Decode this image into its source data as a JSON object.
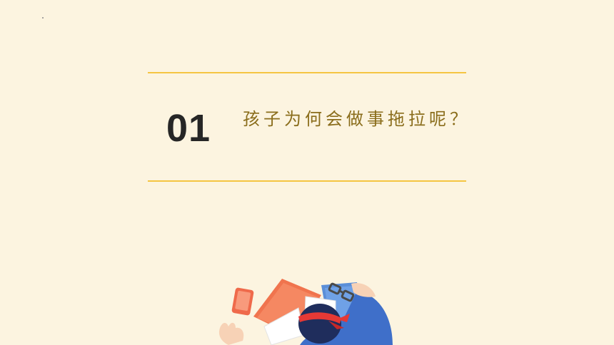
{
  "section": {
    "number": "01",
    "title": "孩子为何会做事拖拉呢？"
  },
  "colors": {
    "background": "#fcf4e0",
    "rule": "#f5c542",
    "number": "#262626",
    "title": "#8a6d1b"
  },
  "illustration": {
    "icon": "student-sleeping-on-books-illustration"
  }
}
